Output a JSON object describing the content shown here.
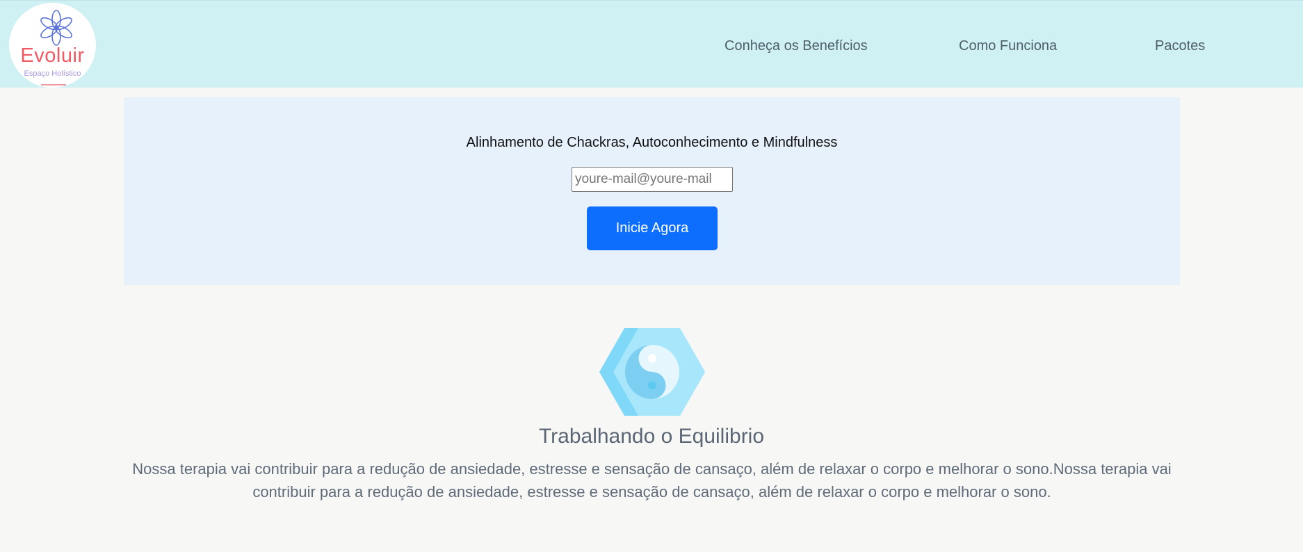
{
  "brand": {
    "name": "Evoluir",
    "tagline": "Espaço Holístico",
    "logo_icon": "lotus-flower-icon",
    "name_color": "#ef5b63",
    "flower_color": "#5b73d8"
  },
  "nav": {
    "links": [
      {
        "label": "Conheça os Benefícios"
      },
      {
        "label": "Como Funciona"
      },
      {
        "label": "Pacotes"
      }
    ]
  },
  "hero": {
    "headline": "Alinhamento de Chackras, Autoconhecimento e Mindfulness",
    "email_placeholder": "youre-mail@youre-mail",
    "email_value": "",
    "cta_label": "Inicie Agora",
    "cta_color": "#0d6efd"
  },
  "feature": {
    "icon": "yin-yang-icon",
    "title": "Trabalhando o Equilibrio",
    "description": "Nossa terapia vai contribuir para a redução de ansiedade, estresse e sensação de cansaço, além de relaxar o corpo e melhorar o sono.Nossa terapia vai contribuir para a redução de ansiedade, estresse e sensação de cansaço, além de relaxar o corpo e melhorar o sono."
  }
}
